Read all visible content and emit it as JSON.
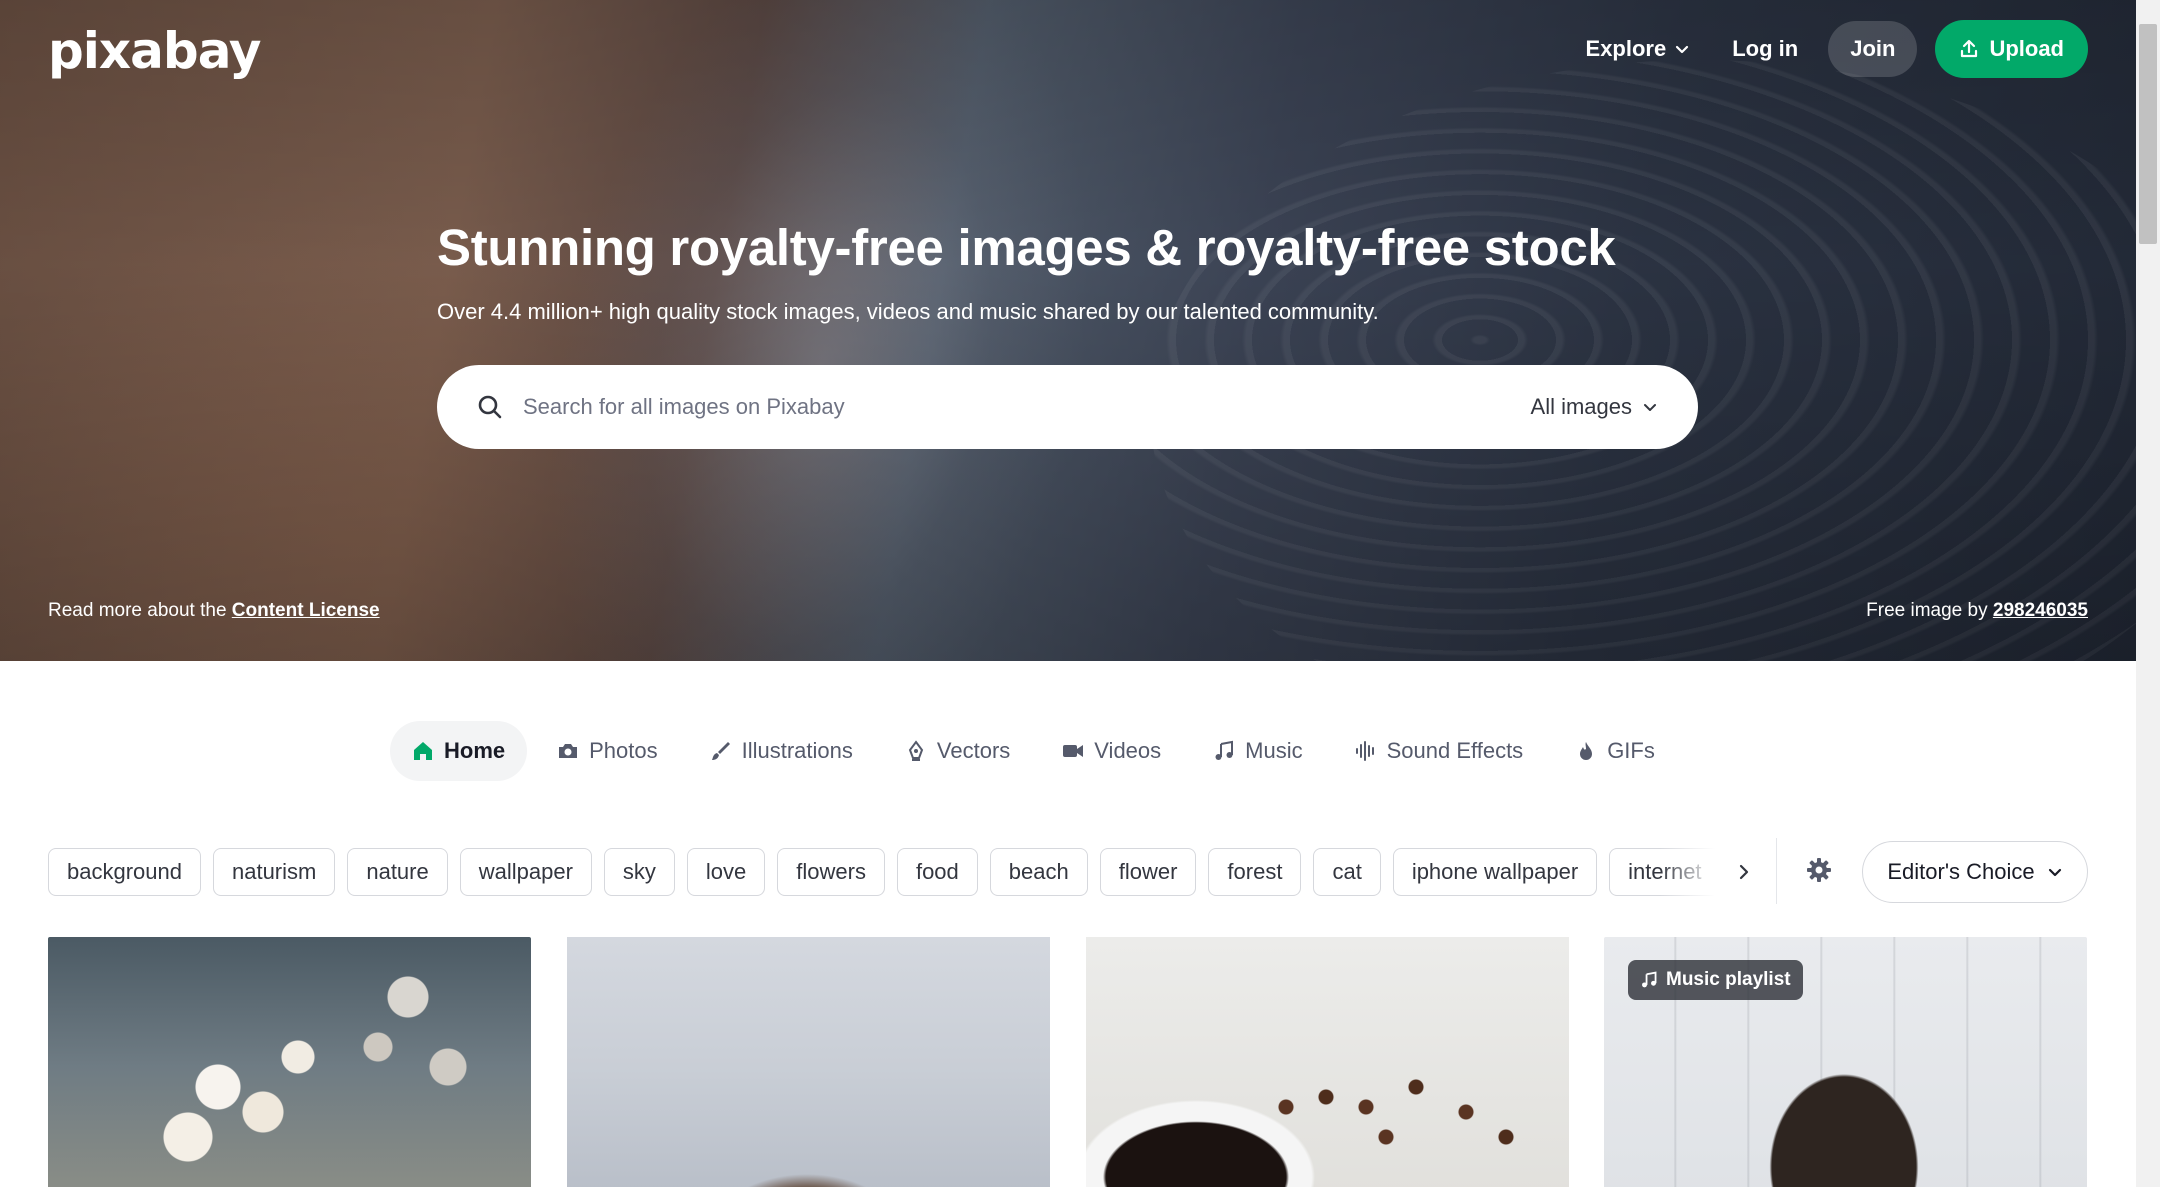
{
  "header": {
    "logo_text": "pixabay",
    "nav": {
      "explore_label": "Explore",
      "login_label": "Log in",
      "join_label": "Join",
      "upload_label": "Upload"
    }
  },
  "hero": {
    "title": "Stunning royalty-free images & royalty-free stock",
    "subtitle": "Over 4.4 million+ high quality stock images, videos and music shared by our talented community.",
    "search": {
      "placeholder": "Search for all images on Pixabay",
      "filter_label": "All images"
    },
    "license_prefix": "Read more about the ",
    "license_link": "Content License",
    "credit_prefix": "Free image by ",
    "credit_user": "298246035"
  },
  "media_tabs": [
    {
      "label": "Home",
      "icon": "home-icon",
      "active": true
    },
    {
      "label": "Photos",
      "icon": "camera-icon"
    },
    {
      "label": "Illustrations",
      "icon": "brush-icon"
    },
    {
      "label": "Vectors",
      "icon": "pen-nib-icon"
    },
    {
      "label": "Videos",
      "icon": "video-camera-icon"
    },
    {
      "label": "Music",
      "icon": "music-note-icon"
    },
    {
      "label": "Sound Effects",
      "icon": "waveform-icon"
    },
    {
      "label": "GIFs",
      "icon": "flame-icon"
    }
  ],
  "tags": [
    "background",
    "naturism",
    "nature",
    "wallpaper",
    "sky",
    "love",
    "flowers",
    "food",
    "beach",
    "flower",
    "forest",
    "cat",
    "iphone wallpaper",
    "internet"
  ],
  "sort": {
    "label": "Editor's Choice"
  },
  "grid": {
    "badge_label": "Music playlist"
  },
  "colors": {
    "accent": "#02a969",
    "text": "#191b26",
    "chip_border": "#d6d8dd"
  }
}
